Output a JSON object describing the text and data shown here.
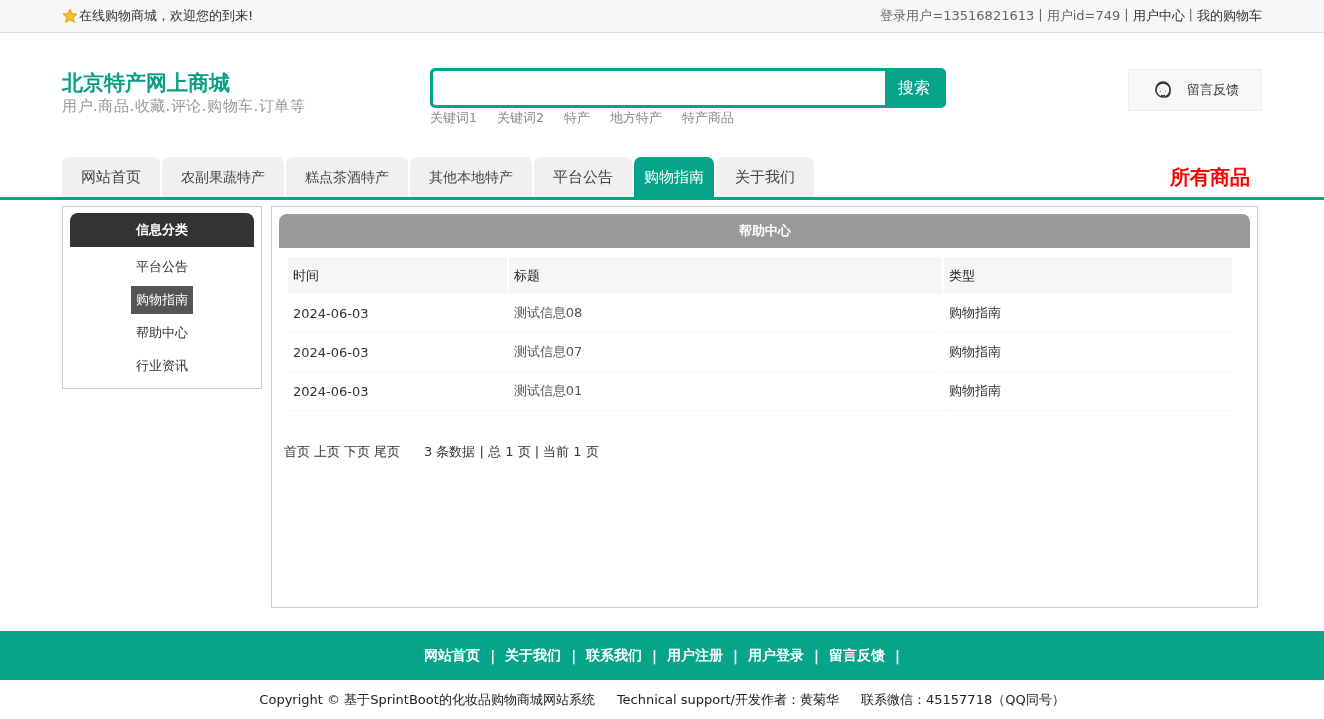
{
  "top_bar": {
    "welcome": "在线购物商城，欢迎您的到来!",
    "user": "登录用户=13516821613",
    "user_id": "用户id=749",
    "links": [
      "用户中心",
      "我的购物车"
    ],
    "separator": "|"
  },
  "header": {
    "title": "北京特产网上商城",
    "subtitle": "用户.商品.收藏.评论.购物车.订单等",
    "search": {
      "button": "搜索",
      "keywords": [
        "关键词1",
        "关键词2",
        "特产",
        "地方特产",
        "特产商品"
      ]
    },
    "feedback": "留言反馈"
  },
  "nav": {
    "tabs": [
      {
        "label": "网站首页",
        "selected": false
      },
      {
        "label": "农副果蔬特产",
        "selected": false
      },
      {
        "label": "糕点茶酒特产",
        "selected": false
      },
      {
        "label": "其他本地特产",
        "selected": false
      },
      {
        "label": "平台公告",
        "selected": false
      },
      {
        "label": "购物指南",
        "selected": true
      },
      {
        "label": "关于我们",
        "selected": false
      }
    ],
    "all_products": "所有商品"
  },
  "sidebar": {
    "title": "信息分类",
    "items": [
      {
        "label": "平台公告",
        "selected": false
      },
      {
        "label": "购物指南",
        "selected": true
      },
      {
        "label": "帮助中心",
        "selected": false
      },
      {
        "label": "行业资讯",
        "selected": false
      }
    ]
  },
  "panel": {
    "title": "帮助中心",
    "table": {
      "columns": [
        "时间",
        "标题",
        "类型"
      ],
      "rows": [
        [
          "2024-06-03",
          "测试信息08",
          "购物指南"
        ],
        [
          "2024-06-03",
          "测试信息07",
          "购物指南"
        ],
        [
          "2024-06-03",
          "测试信息01",
          "购物指南"
        ]
      ]
    },
    "pagination": {
      "links": [
        "首页",
        "上页",
        "下页",
        "尾页"
      ],
      "summary": "3 条数据 | 总 1 页 | 当前 1 页"
    }
  },
  "footer": {
    "links": [
      "网站首页",
      "关于我们",
      "联系我们",
      "用户注册",
      "用户登录",
      "留言反馈"
    ],
    "separator": "|",
    "copyright": "Copyright © 基于SprintBoot的化妆品购物商城网站系统",
    "support": "Technical support/开发作者：黄菊华",
    "contact": "联系微信：45157718（QQ同号）"
  }
}
